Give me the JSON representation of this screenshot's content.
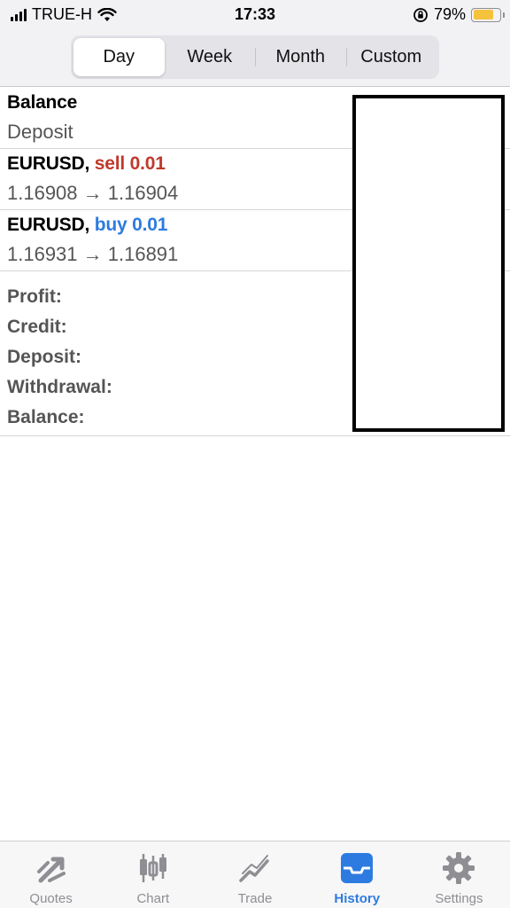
{
  "status_bar": {
    "carrier": "TRUE-H",
    "time": "17:33",
    "battery_percent": "79%",
    "battery_level": 0.79,
    "battery_color": "#f5c33b"
  },
  "period_tabs": [
    {
      "label": "Day",
      "active": true
    },
    {
      "label": "Week",
      "active": false
    },
    {
      "label": "Month",
      "active": false
    },
    {
      "label": "Custom",
      "active": false
    }
  ],
  "history": [
    {
      "title": "Balance",
      "subtitle": "Deposit"
    },
    {
      "symbol": "EURUSD,",
      "side": "sell 0.01",
      "side_color": "#c0392b",
      "prices": "1.16908 → 1.16904"
    },
    {
      "symbol": "EURUSD,",
      "side": "buy 0.01",
      "side_color": "#2d7be0",
      "prices": "1.16931 → 1.16891"
    }
  ],
  "summary": {
    "profit": "Profit:",
    "credit": "Credit:",
    "deposit": "Deposit:",
    "withdrawal": "Withdrawal:",
    "balance": "Balance:"
  },
  "tabbar": {
    "items": [
      {
        "label": "Quotes",
        "icon": "quotes-icon"
      },
      {
        "label": "Chart",
        "icon": "chart-icon"
      },
      {
        "label": "Trade",
        "icon": "trade-icon"
      },
      {
        "label": "History",
        "icon": "history-icon"
      },
      {
        "label": "Settings",
        "icon": "settings-icon"
      }
    ],
    "active": "History",
    "active_color": "#2d7be0",
    "inactive_color": "#8e8e93"
  }
}
